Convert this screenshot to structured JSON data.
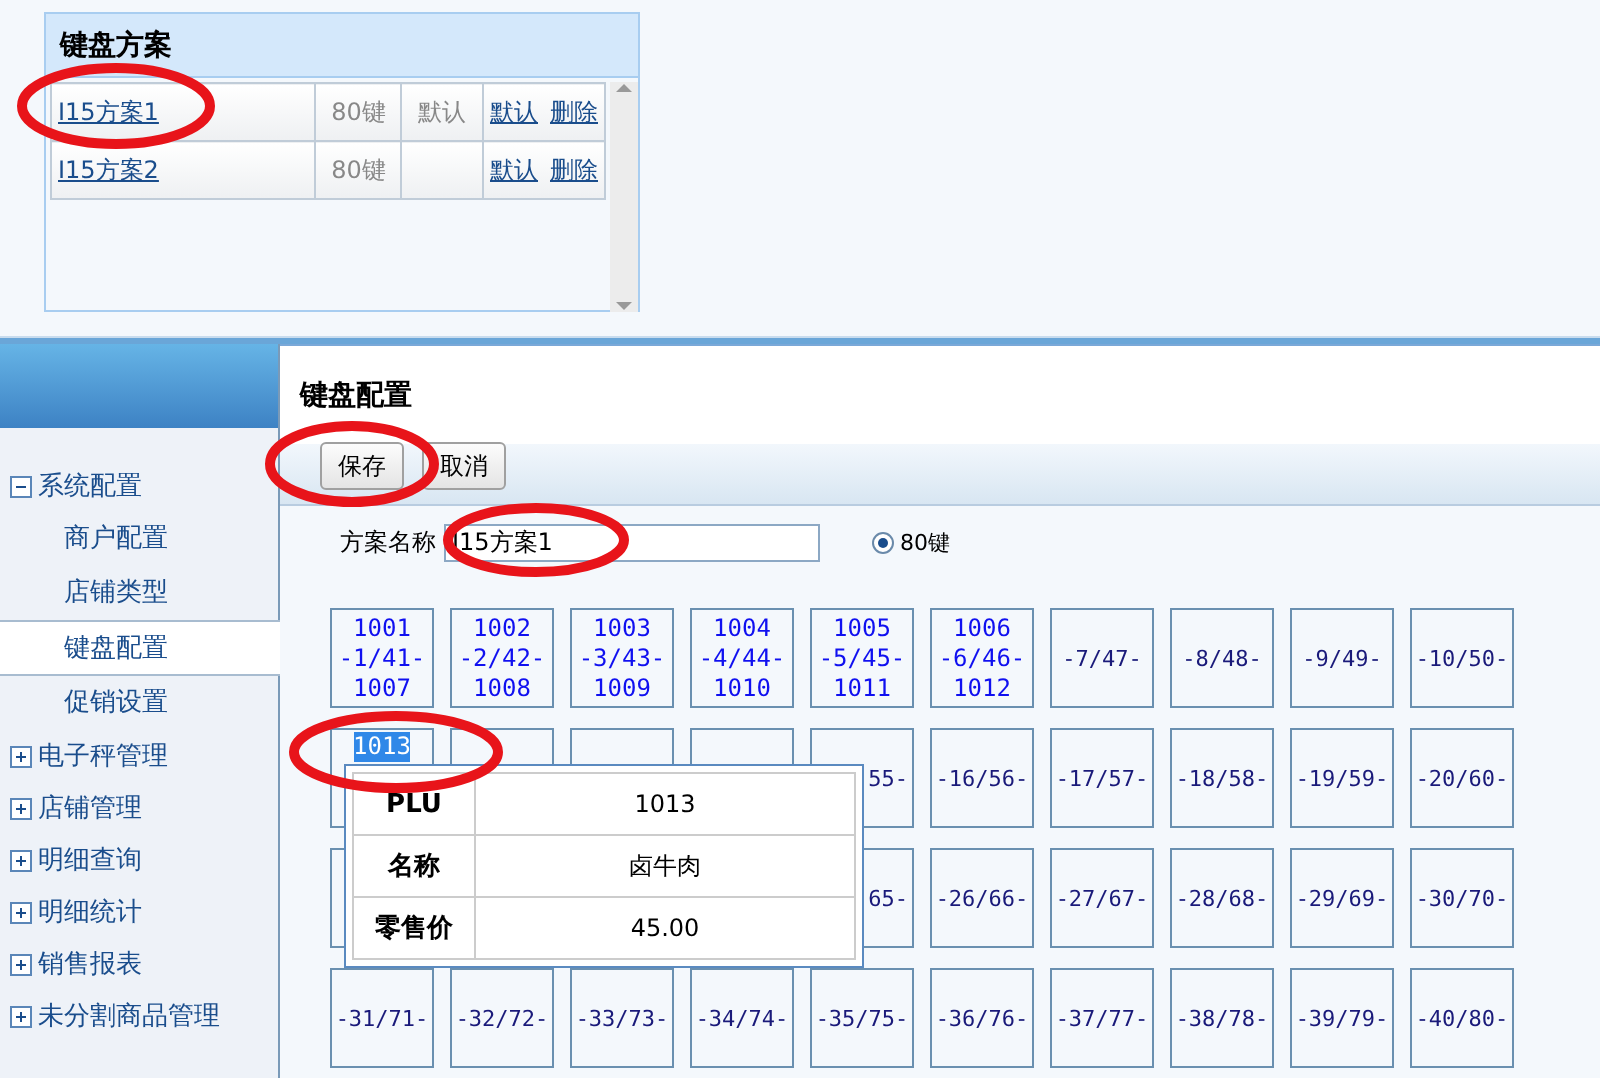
{
  "plans_panel": {
    "title": "键盘方案",
    "rows": [
      {
        "name": "I15方案1",
        "keys": "80键",
        "status": "默认",
        "actions": [
          "默认",
          "删除"
        ]
      },
      {
        "name": "I15方案2",
        "keys": "80键",
        "status": "",
        "actions": [
          "默认",
          "删除"
        ]
      }
    ]
  },
  "sidebar": {
    "items": [
      {
        "label": "系统配置",
        "expanded": true,
        "children": [
          {
            "label": "商户配置",
            "selected": false
          },
          {
            "label": "店铺类型",
            "selected": false
          },
          {
            "label": "键盘配置",
            "selected": true
          },
          {
            "label": "促销设置",
            "selected": false
          }
        ]
      },
      {
        "label": "电子秤管理",
        "expanded": false
      },
      {
        "label": "店铺管理",
        "expanded": false
      },
      {
        "label": "明细查询",
        "expanded": false
      },
      {
        "label": "明细统计",
        "expanded": false
      },
      {
        "label": "销售报表",
        "expanded": false
      },
      {
        "label": "未分割商品管理",
        "expanded": false
      }
    ]
  },
  "config": {
    "title": "键盘配置",
    "buttons": [
      "保存",
      "取消"
    ],
    "name_label": "方案名称",
    "name_value": "I15方案1",
    "layouts": [
      {
        "label": "80键",
        "selected": true
      }
    ],
    "keys": [
      {
        "lines": [
          "1001",
          "-1/41-",
          "1007"
        ],
        "assigned": true
      },
      {
        "lines": [
          "1002",
          "-2/42-",
          "1008"
        ],
        "assigned": true
      },
      {
        "lines": [
          "1003",
          "-3/43-",
          "1009"
        ],
        "assigned": true
      },
      {
        "lines": [
          "1004",
          "-4/44-",
          "1010"
        ],
        "assigned": true
      },
      {
        "lines": [
          "1005",
          "-5/45-",
          "1011"
        ],
        "assigned": true
      },
      {
        "lines": [
          "1006",
          "-6/46-",
          "1012"
        ],
        "assigned": true
      },
      {
        "lines": [
          "-7/47-"
        ],
        "assigned": false
      },
      {
        "lines": [
          "-8/48-"
        ],
        "assigned": false
      },
      {
        "lines": [
          "-9/49-"
        ],
        "assigned": false
      },
      {
        "lines": [
          "-10/50-"
        ],
        "assigned": false
      },
      {
        "lines": [
          "1013"
        ],
        "assigned": true,
        "text_selected": true
      },
      {
        "lines": [
          "55-"
        ],
        "assigned": false,
        "covered": true
      },
      {
        "lines": [
          "-16/56-"
        ],
        "assigned": false
      },
      {
        "lines": [
          "-17/57-"
        ],
        "assigned": false
      },
      {
        "lines": [
          "-18/58-"
        ],
        "assigned": false
      },
      {
        "lines": [
          "-19/59-"
        ],
        "assigned": false
      },
      {
        "lines": [
          "-20/60-"
        ],
        "assigned": false
      },
      {
        "lines": [
          "65-"
        ],
        "assigned": false,
        "covered": true
      },
      {
        "lines": [
          "-26/66-"
        ],
        "assigned": false
      },
      {
        "lines": [
          "-27/67-"
        ],
        "assigned": false
      },
      {
        "lines": [
          "-28/68-"
        ],
        "assigned": false
      },
      {
        "lines": [
          "-29/69-"
        ],
        "assigned": false
      },
      {
        "lines": [
          "-30/70-"
        ],
        "assigned": false
      },
      {
        "lines": [
          "-31/71-"
        ],
        "assigned": false
      },
      {
        "lines": [
          "-32/72-"
        ],
        "assigned": false
      },
      {
        "lines": [
          "-33/73-"
        ],
        "assigned": false
      },
      {
        "lines": [
          "-34/74-"
        ],
        "assigned": false
      },
      {
        "lines": [
          "-35/75-"
        ],
        "assigned": false
      },
      {
        "lines": [
          "-36/76-"
        ],
        "assigned": false
      },
      {
        "lines": [
          "-37/77-"
        ],
        "assigned": false
      },
      {
        "lines": [
          "-38/78-"
        ],
        "assigned": false
      },
      {
        "lines": [
          "-39/79-"
        ],
        "assigned": false
      },
      {
        "lines": [
          "-40/80-"
        ],
        "assigned": false
      }
    ],
    "tooltip": {
      "rows": [
        {
          "label": "PLU",
          "value": "1013"
        },
        {
          "label": "名称",
          "value": "卤牛肉"
        },
        {
          "label": "零售价",
          "value": "45.00"
        }
      ]
    }
  },
  "annotations": [
    {
      "kind": "ellipse"
    },
    {
      "kind": "ellipse"
    },
    {
      "kind": "ellipse"
    },
    {
      "kind": "ellipse"
    }
  ]
}
